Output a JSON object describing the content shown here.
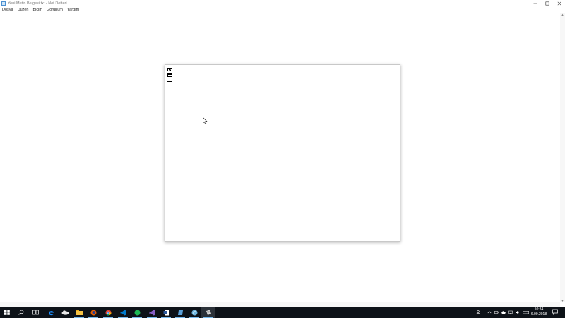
{
  "window": {
    "title": "Yeni Metin Belgesi.txt - Not Defteri",
    "controls": {
      "minimize": "minimize-icon",
      "maximize": "maximize-icon",
      "close": "close-icon"
    }
  },
  "menu": {
    "items": [
      {
        "label": "Dosya"
      },
      {
        "label": "Düzen"
      },
      {
        "label": "Biçim"
      },
      {
        "label": "Görünüm"
      },
      {
        "label": "Yardım"
      }
    ]
  },
  "dialog": {
    "buttons": [
      "close-icon",
      "maximize-icon",
      "minimize-icon"
    ]
  },
  "taskbar": {
    "apps": [
      {
        "name": "start",
        "icon": "windows-logo-icon",
        "color": "#ffffff"
      },
      {
        "name": "search",
        "icon": "search-icon",
        "color": "#ffffff"
      },
      {
        "name": "task-view",
        "icon": "task-view-icon",
        "color": "#ffffff"
      },
      {
        "name": "edge",
        "icon": "edge-icon",
        "color": "#1e90ff"
      },
      {
        "name": "unknown-app",
        "icon": "cloud-app-icon",
        "color": "#dcdcdc"
      },
      {
        "name": "file-explorer",
        "icon": "folder-icon",
        "color": "#f6c344"
      },
      {
        "name": "firefox",
        "icon": "firefox-icon",
        "color": "#e66000"
      },
      {
        "name": "chrome",
        "icon": "chrome-icon",
        "color": "#34a853"
      },
      {
        "name": "vscode",
        "icon": "vscode-icon",
        "color": "#007acc"
      },
      {
        "name": "spotify",
        "icon": "spotify-icon",
        "color": "#1db954"
      },
      {
        "name": "word",
        "icon": "word-icon",
        "color": "#2b579a"
      },
      {
        "name": "visual-studio",
        "icon": "visual-studio-icon",
        "color": "#865fc5"
      },
      {
        "name": "app-blue",
        "icon": "app-icon",
        "color": "#5aa0d8"
      },
      {
        "name": "app-globe",
        "icon": "globe-icon",
        "color": "#6fb7e0"
      },
      {
        "name": "notepad",
        "icon": "notepad-icon",
        "color": "#d9d9d9"
      }
    ],
    "clock": {
      "time": "10:34",
      "date": "6.09.2018"
    }
  }
}
